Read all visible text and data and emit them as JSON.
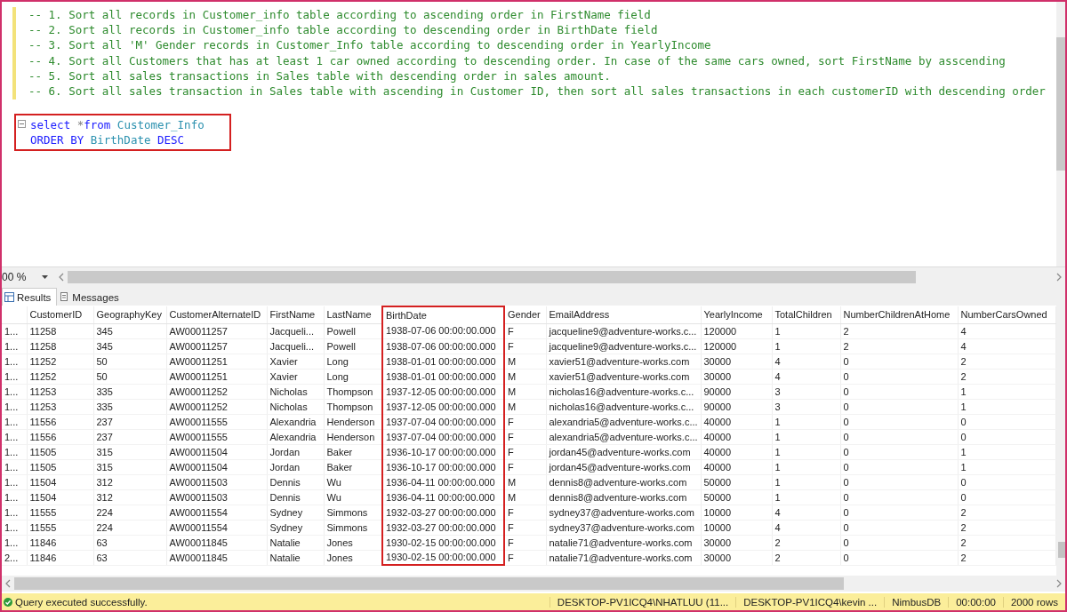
{
  "editor": {
    "comments": [
      "-- 1. Sort all records in Customer_info table according to ascending order in FirstName field",
      "-- 2. Sort all records in Customer_info table according to descending order in BirthDate field",
      "-- 3. Sort all 'M' Gender records in Customer_Info table according to descending order in YearlyIncome",
      "-- 4. Sort all Customers that has at least 1 car owned according to descending order. In case of the same cars owned, sort FirstName by asscending",
      "-- 5. Sort all sales transactions in Sales table with descending order in sales amount.",
      "-- 6. Sort all sales transaction in Sales table with ascending in Customer ID, then sort all sales transactions in each customerID with descending order"
    ],
    "query": {
      "highlighted": true,
      "lines": [
        [
          {
            "text": "select ",
            "kind": "keyword"
          },
          {
            "text": "*",
            "kind": "operator"
          },
          {
            "text": "from ",
            "kind": "keyword"
          },
          {
            "text": "Customer_Info",
            "kind": "identifier"
          }
        ],
        [
          {
            "text": "ORDER BY ",
            "kind": "keyword"
          },
          {
            "text": "BirthDate ",
            "kind": "identifier"
          },
          {
            "text": "DESC",
            "kind": "keyword"
          }
        ]
      ]
    }
  },
  "zoom": {
    "value": "00 %"
  },
  "result_tabs": [
    {
      "label": "Results",
      "selected": true
    },
    {
      "label": "Messages",
      "selected": false
    }
  ],
  "grid": {
    "columns": [
      {
        "highlighted": false
      },
      {
        "label": "CustomerID",
        "highlighted": false
      },
      {
        "label": "GeographyKey",
        "highlighted": false
      },
      {
        "label": "CustomerAlternateID",
        "highlighted": false
      },
      {
        "label": "FirstName",
        "highlighted": false
      },
      {
        "label": "LastName",
        "highlighted": false
      },
      {
        "label": "BirthDate",
        "highlighted": true
      },
      {
        "label": "Gender",
        "highlighted": false
      },
      {
        "label": "EmailAddress",
        "highlighted": false
      },
      {
        "label": "YearlyIncome",
        "highlighted": false
      },
      {
        "label": "TotalChildren",
        "highlighted": false
      },
      {
        "label": "NumberChildrenAtHome",
        "highlighted": false
      },
      {
        "label": "NumberCarsOwned",
        "highlighted": false
      }
    ],
    "rows": [
      [
        "1...",
        "11258",
        "345",
        "AW00011257",
        "Jacqueli...",
        "Powell",
        "1938-07-06 00:00:00.000",
        "F",
        "jacqueline9@adventure-works.c...",
        "120000",
        "1",
        "2",
        "4"
      ],
      [
        "1...",
        "11258",
        "345",
        "AW00011257",
        "Jacqueli...",
        "Powell",
        "1938-07-06 00:00:00.000",
        "F",
        "jacqueline9@adventure-works.c...",
        "120000",
        "1",
        "2",
        "4"
      ],
      [
        "1...",
        "11252",
        "50",
        "AW00011251",
        "Xavier",
        "Long",
        "1938-01-01 00:00:00.000",
        "M",
        "xavier51@adventure-works.com",
        "30000",
        "4",
        "0",
        "2"
      ],
      [
        "1...",
        "11252",
        "50",
        "AW00011251",
        "Xavier",
        "Long",
        "1938-01-01 00:00:00.000",
        "M",
        "xavier51@adventure-works.com",
        "30000",
        "4",
        "0",
        "2"
      ],
      [
        "1...",
        "11253",
        "335",
        "AW00011252",
        "Nicholas",
        "Thompson",
        "1937-12-05 00:00:00.000",
        "M",
        "nicholas16@adventure-works.c...",
        "90000",
        "3",
        "0",
        "1"
      ],
      [
        "1...",
        "11253",
        "335",
        "AW00011252",
        "Nicholas",
        "Thompson",
        "1937-12-05 00:00:00.000",
        "M",
        "nicholas16@adventure-works.c...",
        "90000",
        "3",
        "0",
        "1"
      ],
      [
        "1...",
        "11556",
        "237",
        "AW00011555",
        "Alexandria",
        "Henderson",
        "1937-07-04 00:00:00.000",
        "F",
        "alexandria5@adventure-works.c...",
        "40000",
        "1",
        "0",
        "0"
      ],
      [
        "1...",
        "11556",
        "237",
        "AW00011555",
        "Alexandria",
        "Henderson",
        "1937-07-04 00:00:00.000",
        "F",
        "alexandria5@adventure-works.c...",
        "40000",
        "1",
        "0",
        "0"
      ],
      [
        "1...",
        "11505",
        "315",
        "AW00011504",
        "Jordan",
        "Baker",
        "1936-10-17 00:00:00.000",
        "F",
        "jordan45@adventure-works.com",
        "40000",
        "1",
        "0",
        "1"
      ],
      [
        "1...",
        "11505",
        "315",
        "AW00011504",
        "Jordan",
        "Baker",
        "1936-10-17 00:00:00.000",
        "F",
        "jordan45@adventure-works.com",
        "40000",
        "1",
        "0",
        "1"
      ],
      [
        "1...",
        "11504",
        "312",
        "AW00011503",
        "Dennis",
        "Wu",
        "1936-04-11 00:00:00.000",
        "M",
        "dennis8@adventure-works.com",
        "50000",
        "1",
        "0",
        "0"
      ],
      [
        "1...",
        "11504",
        "312",
        "AW00011503",
        "Dennis",
        "Wu",
        "1936-04-11 00:00:00.000",
        "M",
        "dennis8@adventure-works.com",
        "50000",
        "1",
        "0",
        "0"
      ],
      [
        "1...",
        "11555",
        "224",
        "AW00011554",
        "Sydney",
        "Simmons",
        "1932-03-27 00:00:00.000",
        "F",
        "sydney37@adventure-works.com",
        "10000",
        "4",
        "0",
        "2"
      ],
      [
        "1...",
        "11555",
        "224",
        "AW00011554",
        "Sydney",
        "Simmons",
        "1932-03-27 00:00:00.000",
        "F",
        "sydney37@adventure-works.com",
        "10000",
        "4",
        "0",
        "2"
      ],
      [
        "1...",
        "11846",
        "63",
        "AW00011845",
        "Natalie",
        "Jones",
        "1930-02-15 00:00:00.000",
        "F",
        "natalie71@adventure-works.com",
        "30000",
        "2",
        "0",
        "2"
      ],
      [
        "2...",
        "11846",
        "63",
        "AW00011845",
        "Natalie",
        "Jones",
        "1930-02-15 00:00:00.000",
        "F",
        "natalie71@adventure-works.com",
        "30000",
        "2",
        "0",
        "2"
      ]
    ]
  },
  "status_bar": {
    "message": "Query executed successfully.",
    "segments": [
      "DESKTOP-PV1ICQ4\\NHATLUU (11...",
      "DESKTOP-PV1ICQ4\\kevin ...",
      "NimbusDB",
      "00:00:00",
      "2000 rows"
    ]
  }
}
